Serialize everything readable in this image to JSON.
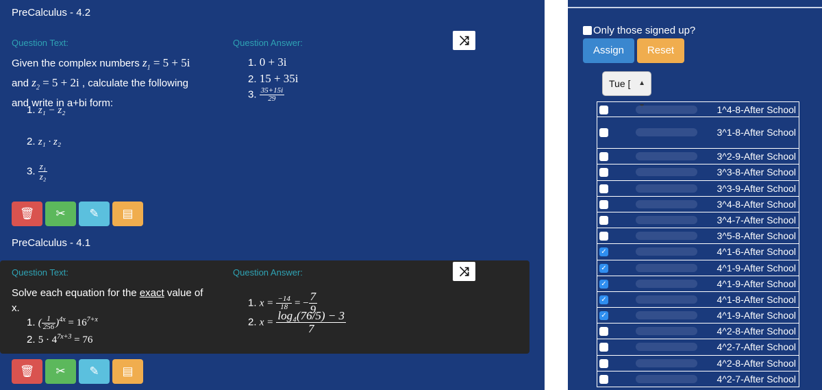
{
  "question1": {
    "title": "PreCalculus - 4.2",
    "text_label": "Question Text:",
    "answer_label": "Question Answer:",
    "text_line1_pre": "Given the complex numbers",
    "z1": "z",
    "z1_def": "= 5 + 5i",
    "text_line2_pre": "and",
    "z2_def": "= 5 + 2i",
    "text_line2_post": ", calculate the following",
    "text_line3": "and write in a+bi form:",
    "items": [
      "1.",
      "2.",
      "3."
    ],
    "item1": "z₁ − z₂",
    "item2": "z₁ · z₂",
    "item3_num": "z₁",
    "item3_den": "z₂",
    "answers": [
      "1.",
      "2.",
      "3."
    ],
    "ans1": "0 + 3i",
    "ans2": "15 + 35i",
    "ans3_num": "35+15i",
    "ans3_den": "29"
  },
  "question2": {
    "title": "PreCalculus - 4.1",
    "text_label": "Question Text:",
    "answer_label": "Question Answer:",
    "text_line1_pre": "Solve each equation for the",
    "text_line1_u": "exact",
    "text_line1_post": "value of",
    "text_line2": "x.",
    "item1_frac_num": "1",
    "item1_frac_den": "256",
    "item1_exp": "4x",
    "item1_rhs": "= 16",
    "item1_rhs_exp": "7+x",
    "item2": "5 · 4",
    "item2_exp": "7x+3",
    "item2_rhs": "= 76",
    "ans1_pre": "x =",
    "ans1_f1_num": "−14",
    "ans1_f1_den": "18",
    "ans1_mid": "= −",
    "ans1_f2_num": "7",
    "ans1_f2_den": "9",
    "ans2_pre": "x =",
    "ans2_num": "log₄(76/5) − 3",
    "ans2_den": "7"
  },
  "icons": {
    "shuffle": "shuffle-icon",
    "delete": "trash-icon",
    "copy": "clipboard-icon",
    "edit": "pencil-icon",
    "list": "list-icon"
  },
  "glyphs": {
    "shuffle": "⤨",
    "delete": "🗑",
    "copy": "✂",
    "edit": "✎",
    "list": "▤",
    "check": "✓",
    "arrows": "▴▾"
  },
  "right_panel": {
    "signed_up_label": "Only those signed up?",
    "assign_label": "Assign",
    "reset_label": "Reset",
    "date_value": "Tue [",
    "classes": [
      {
        "name": "1^4-8-After School",
        "checked": false
      },
      {
        "name": "3^1-8-After School",
        "checked": false
      },
      {
        "name": "3^2-9-After School",
        "checked": false
      },
      {
        "name": "3^3-8-After School",
        "checked": false
      },
      {
        "name": "3^3-9-After School",
        "checked": false
      },
      {
        "name": "3^4-8-After School",
        "checked": false
      },
      {
        "name": "3^4-7-After School",
        "checked": false
      },
      {
        "name": "3^5-8-After School",
        "checked": false
      },
      {
        "name": "4^1-6-After School",
        "checked": true
      },
      {
        "name": "4^1-9-After School",
        "checked": true
      },
      {
        "name": "4^1-9-After School",
        "checked": true
      },
      {
        "name": "4^1-8-After School",
        "checked": true
      },
      {
        "name": "4^1-9-After School",
        "checked": true
      },
      {
        "name": "4^2-8-After School",
        "checked": false
      },
      {
        "name": "4^2-7-After School",
        "checked": false
      },
      {
        "name": "4^2-8-After School",
        "checked": false
      },
      {
        "name": "4^2-7-After School",
        "checked": false
      }
    ]
  },
  "colors": {
    "background": "#1a3a7c",
    "dark_card": "#262626",
    "label_teal": "#2fa3b4",
    "danger": "#d9534f",
    "success": "#5cb85c",
    "info": "#5bc0de",
    "warning": "#f0ad4e",
    "primary": "#3a87cf"
  }
}
